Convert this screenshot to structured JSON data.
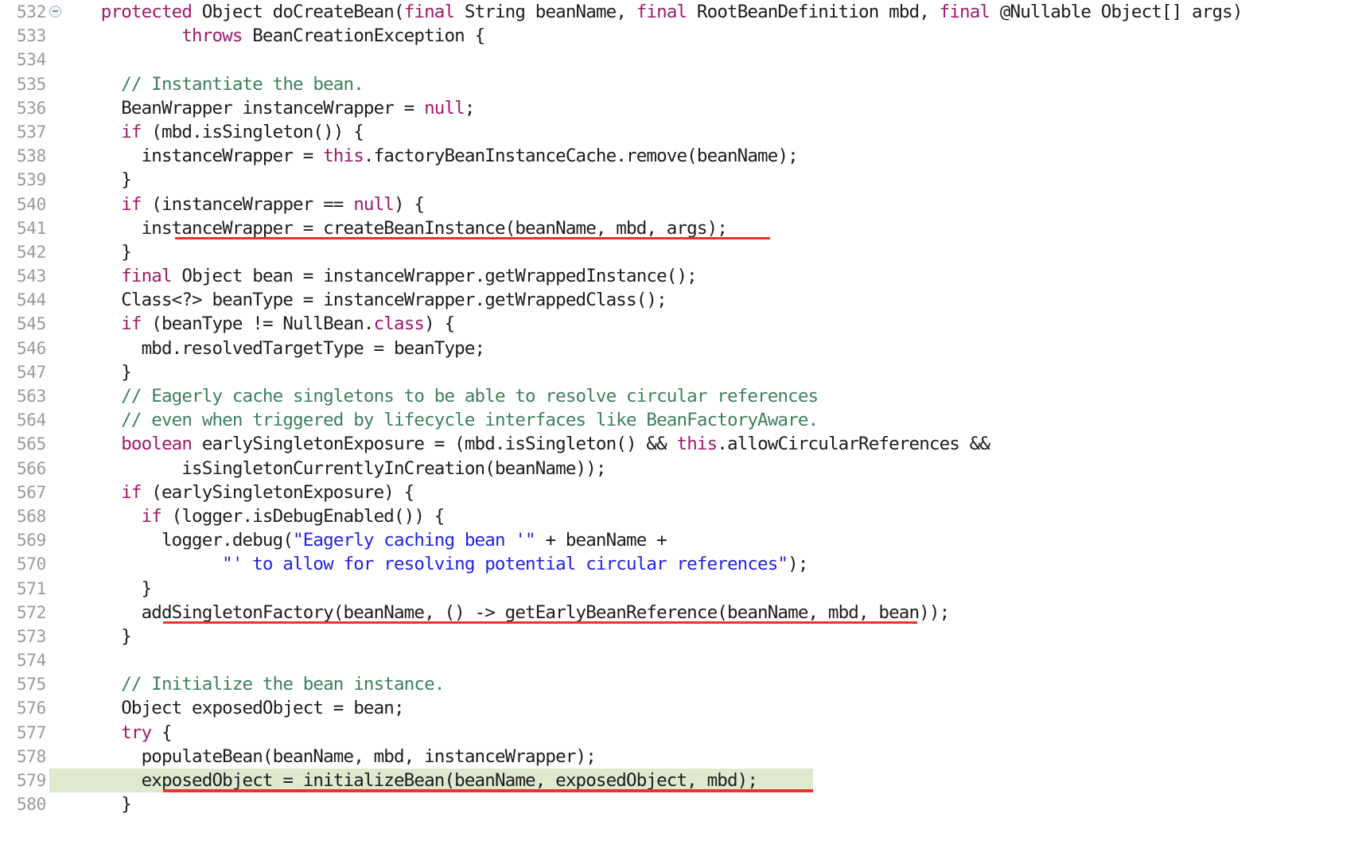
{
  "editor": {
    "language": "java",
    "colors": {
      "background": "#ffffff",
      "text": "#1c1c1c",
      "keyword": "#9b1d6b",
      "comment": "#3d7f5d",
      "string": "#2222e0",
      "line_number": "#9a9a9a",
      "highlight_line_background": "#e0e8d0",
      "underline": "#e8352a",
      "fold_icon": "#aab4bd"
    },
    "fold_icon_name": "collapse-minus-circle-icon",
    "highlighted_line": "579",
    "underlined_lines": [
      "541",
      "572",
      "579"
    ],
    "lines": [
      {
        "num": "532",
        "fold": true,
        "indent": 2,
        "tokens": [
          {
            "t": "kw",
            "s": "protected "
          },
          {
            "t": "pln",
            "s": "Object doCreateBean("
          },
          {
            "t": "kw",
            "s": "final "
          },
          {
            "t": "pln",
            "s": "String beanName, "
          },
          {
            "t": "kw",
            "s": "final "
          },
          {
            "t": "pln",
            "s": "RootBeanDefinition mbd, "
          },
          {
            "t": "kw",
            "s": "final "
          },
          {
            "t": "pln",
            "s": "@Nullable Object[] args)"
          }
        ]
      },
      {
        "num": "533",
        "fold": false,
        "indent": 6,
        "tokens": [
          {
            "t": "kw",
            "s": "throws "
          },
          {
            "t": "pln",
            "s": "BeanCreationException {"
          }
        ]
      },
      {
        "num": "534",
        "fold": false,
        "indent": 0,
        "tokens": []
      },
      {
        "num": "535",
        "fold": false,
        "indent": 3,
        "tokens": [
          {
            "t": "cm",
            "s": "// Instantiate the bean."
          }
        ]
      },
      {
        "num": "536",
        "fold": false,
        "indent": 3,
        "tokens": [
          {
            "t": "pln",
            "s": "BeanWrapper instanceWrapper = "
          },
          {
            "t": "kw",
            "s": "null"
          },
          {
            "t": "pln",
            "s": ";"
          }
        ]
      },
      {
        "num": "537",
        "fold": false,
        "indent": 3,
        "tokens": [
          {
            "t": "kw",
            "s": "if "
          },
          {
            "t": "pln",
            "s": "(mbd.isSingleton()) {"
          }
        ]
      },
      {
        "num": "538",
        "fold": false,
        "indent": 4,
        "tokens": [
          {
            "t": "pln",
            "s": "instanceWrapper = "
          },
          {
            "t": "kw",
            "s": "this"
          },
          {
            "t": "pln",
            "s": ".factoryBeanInstanceCache.remove(beanName);"
          }
        ]
      },
      {
        "num": "539",
        "fold": false,
        "indent": 3,
        "tokens": [
          {
            "t": "pln",
            "s": "}"
          }
        ]
      },
      {
        "num": "540",
        "fold": false,
        "indent": 3,
        "tokens": [
          {
            "t": "kw",
            "s": "if "
          },
          {
            "t": "pln",
            "s": "(instanceWrapper == "
          },
          {
            "t": "kw",
            "s": "null"
          },
          {
            "t": "pln",
            "s": ") {"
          }
        ]
      },
      {
        "num": "541",
        "fold": false,
        "indent": 4,
        "underline": {
          "start": 220,
          "end": 968
        },
        "tokens": [
          {
            "t": "pln",
            "s": "instanceWrapper = createBeanInstance(beanName, mbd, args);"
          }
        ]
      },
      {
        "num": "542",
        "fold": false,
        "indent": 3,
        "tokens": [
          {
            "t": "pln",
            "s": "}"
          }
        ]
      },
      {
        "num": "543",
        "fold": false,
        "indent": 3,
        "tokens": [
          {
            "t": "kw",
            "s": "final "
          },
          {
            "t": "pln",
            "s": "Object bean = instanceWrapper.getWrappedInstance();"
          }
        ]
      },
      {
        "num": "544",
        "fold": false,
        "indent": 3,
        "tokens": [
          {
            "t": "pln",
            "s": "Class<?> beanType = instanceWrapper.getWrappedClass();"
          }
        ]
      },
      {
        "num": "545",
        "fold": false,
        "indent": 3,
        "tokens": [
          {
            "t": "kw",
            "s": "if "
          },
          {
            "t": "pln",
            "s": "(beanType != NullBean."
          },
          {
            "t": "kw",
            "s": "class"
          },
          {
            "t": "pln",
            "s": ") {"
          }
        ]
      },
      {
        "num": "546",
        "fold": false,
        "indent": 4,
        "tokens": [
          {
            "t": "pln",
            "s": "mbd.resolvedTargetType = beanType;"
          }
        ]
      },
      {
        "num": "547",
        "fold": false,
        "indent": 3,
        "tokens": [
          {
            "t": "pln",
            "s": "}"
          }
        ]
      },
      {
        "num": "563",
        "fold": false,
        "indent": 3,
        "tokens": [
          {
            "t": "cm",
            "s": "// Eagerly cache singletons to be able to resolve circular references"
          }
        ]
      },
      {
        "num": "564",
        "fold": false,
        "indent": 3,
        "tokens": [
          {
            "t": "cm",
            "s": "// even when triggered by lifecycle interfaces like BeanFactoryAware."
          }
        ]
      },
      {
        "num": "565",
        "fold": false,
        "indent": 3,
        "tokens": [
          {
            "t": "kw",
            "s": "boolean "
          },
          {
            "t": "pln",
            "s": "earlySingletonExposure = (mbd.isSingleton() && "
          },
          {
            "t": "kw",
            "s": "this"
          },
          {
            "t": "pln",
            "s": ".allowCircularReferences &&"
          }
        ]
      },
      {
        "num": "566",
        "fold": false,
        "indent": 6,
        "tokens": [
          {
            "t": "pln",
            "s": "isSingletonCurrentlyInCreation(beanName));"
          }
        ]
      },
      {
        "num": "567",
        "fold": false,
        "indent": 3,
        "tokens": [
          {
            "t": "kw",
            "s": "if "
          },
          {
            "t": "pln",
            "s": "(earlySingletonExposure) {"
          }
        ]
      },
      {
        "num": "568",
        "fold": false,
        "indent": 4,
        "tokens": [
          {
            "t": "kw",
            "s": "if "
          },
          {
            "t": "pln",
            "s": "(logger.isDebugEnabled()) {"
          }
        ]
      },
      {
        "num": "569",
        "fold": false,
        "indent": 5,
        "tokens": [
          {
            "t": "pln",
            "s": "logger.debug("
          },
          {
            "t": "str",
            "s": "\"Eagerly caching bean '\""
          },
          {
            "t": "pln",
            "s": " + beanName +"
          }
        ]
      },
      {
        "num": "570",
        "fold": false,
        "indent": 8,
        "tokens": [
          {
            "t": "str",
            "s": "\"' to allow for resolving potential circular references\""
          },
          {
            "t": "pln",
            "s": ");"
          }
        ]
      },
      {
        "num": "571",
        "fold": false,
        "indent": 4,
        "tokens": [
          {
            "t": "pln",
            "s": "}"
          }
        ]
      },
      {
        "num": "572",
        "fold": false,
        "indent": 4,
        "underline": {
          "start": 205,
          "end": 1153
        },
        "tokens": [
          {
            "t": "pln",
            "s": "addSingletonFactory(beanName, () -> getEarlyBeanReference(beanName, mbd, bean));"
          }
        ]
      },
      {
        "num": "573",
        "fold": false,
        "indent": 3,
        "tokens": [
          {
            "t": "pln",
            "s": "}"
          }
        ]
      },
      {
        "num": "574",
        "fold": false,
        "indent": 0,
        "tokens": []
      },
      {
        "num": "575",
        "fold": false,
        "indent": 3,
        "tokens": [
          {
            "t": "cm",
            "s": "// Initialize the bean instance."
          }
        ]
      },
      {
        "num": "576",
        "fold": false,
        "indent": 3,
        "tokens": [
          {
            "t": "pln",
            "s": "Object exposedObject = bean;"
          }
        ]
      },
      {
        "num": "577",
        "fold": false,
        "indent": 3,
        "tokens": [
          {
            "t": "kw",
            "s": "try "
          },
          {
            "t": "pln",
            "s": "{"
          }
        ]
      },
      {
        "num": "578",
        "fold": false,
        "indent": 4,
        "tokens": [
          {
            "t": "pln",
            "s": "populateBean(beanName, mbd, instanceWrapper);"
          }
        ]
      },
      {
        "num": "579",
        "fold": false,
        "indent": 4,
        "highlight": {
          "start": 62,
          "end": 1022
        },
        "underline": {
          "start": 205,
          "end": 1022
        },
        "tokens": [
          {
            "t": "pln",
            "s": "exposedObject = initializeBean(beanName, exposedObject, mbd);"
          }
        ]
      },
      {
        "num": "580",
        "fold": false,
        "indent": 3,
        "tokens": [
          {
            "t": "pln",
            "s": "}"
          }
        ]
      }
    ]
  }
}
